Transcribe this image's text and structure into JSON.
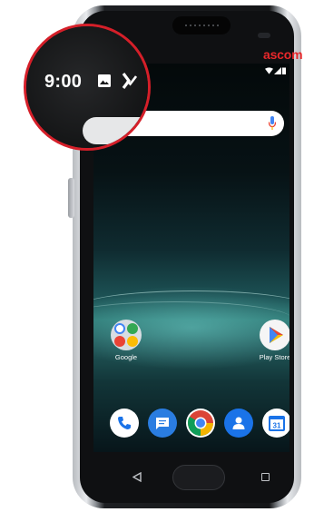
{
  "status_bar": {
    "time": "9:00",
    "notification_icons": [
      "image-icon",
      "checklist-icon"
    ],
    "right_icons": [
      "wifi-icon",
      "signal-icon",
      "battery-icon"
    ]
  },
  "device": {
    "brand": "ascom"
  },
  "search_bar": {
    "icons": [
      "google-mic-icon"
    ]
  },
  "home_apps": [
    {
      "label": "Google",
      "icon": "google-folder-icon"
    },
    {
      "label": "Play Store",
      "icon": "play-store-icon"
    }
  ],
  "dock": [
    "phone-icon",
    "messages-icon",
    "chrome-icon",
    "contacts-icon",
    "calendar-icon"
  ],
  "calendar_day": "31",
  "navigation": [
    "back-icon",
    "home-button",
    "recents-icon"
  ],
  "colors": {
    "accent_red": "#d51f29",
    "brand_red": "#e8282b",
    "google_blue": "#4285f4",
    "google_red": "#ea4335",
    "google_yellow": "#fbbc05",
    "google_green": "#34a853"
  }
}
